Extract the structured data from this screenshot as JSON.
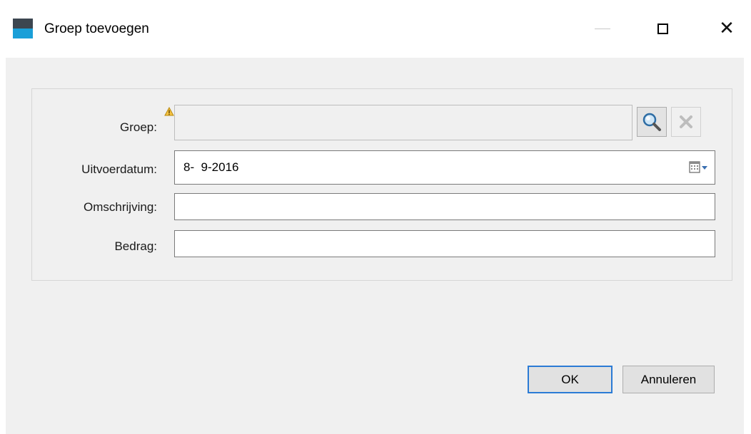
{
  "window": {
    "title": "Groep toevoegen",
    "icons": {
      "app": "app-icon",
      "minimize": "minimize-icon",
      "maximize": "maximize-icon",
      "close": "close-icon"
    }
  },
  "form": {
    "groep": {
      "label": "Groep:",
      "value": "",
      "search_icon": "magnifier-icon",
      "clear_icon": "clear-x-icon",
      "warning_icon": "warning-icon"
    },
    "uitvoerdatum": {
      "label": "Uitvoerdatum:",
      "value": "8-  9-2016",
      "picker_icon": "calendar-dropdown-icon"
    },
    "omschrijving": {
      "label": "Omschrijving:",
      "value": ""
    },
    "bedrag": {
      "label": "Bedrag:",
      "value": ""
    }
  },
  "buttons": {
    "ok": "OK",
    "cancel": "Annuleren"
  },
  "colors": {
    "accent": "#2b7bd5",
    "icon_dark": "#3c4650",
    "icon_blue": "#1a9fd8",
    "dialog_bg": "#f0f0f0"
  }
}
